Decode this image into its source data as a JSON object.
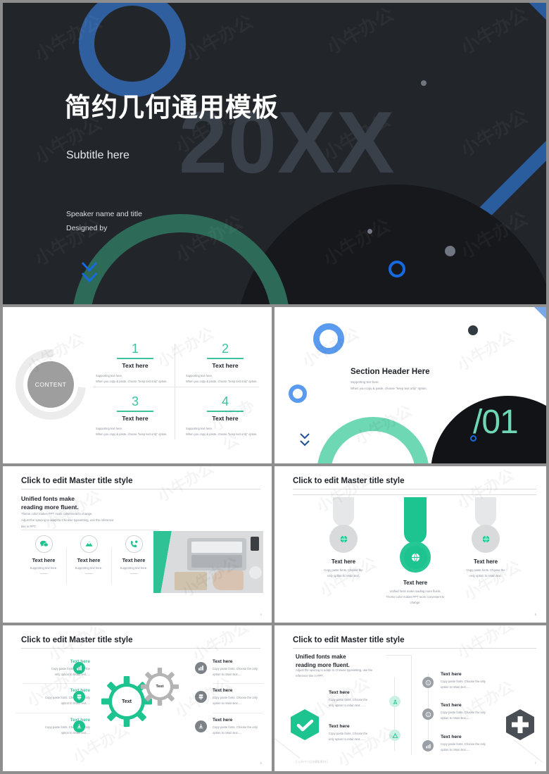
{
  "deck": {
    "accent_teal": "#3ec3a0",
    "accent_green": "#1ec48f",
    "accent_blue": "#2a5d9e",
    "accent_light_blue": "#5b9bef",
    "cover_bg": "#22252a",
    "watermark_text": "小牛办公"
  },
  "slide1": {
    "title": "简约几何通用模板",
    "year": "20XX",
    "subtitle": "Subtitle here",
    "speaker": "Speaker name and title",
    "designer": "Designed by"
  },
  "slide2": {
    "center_label": "CONTENT",
    "items": [
      {
        "num": "1",
        "head": "Text here",
        "sub1": "Supporting text here.",
        "sub2": "When you copy & paste, choose \"keep text only\" option."
      },
      {
        "num": "2",
        "head": "Text here",
        "sub1": "Supporting text here.",
        "sub2": "When you copy & paste, choose \"keep text only\" option."
      },
      {
        "num": "3",
        "head": "Text here",
        "sub1": "Supporting text here.",
        "sub2": "When you copy & paste, choose \"keep text only\" option."
      },
      {
        "num": "4",
        "head": "Text here",
        "sub1": "Supporting text here.",
        "sub2": "When you copy & paste, choose \"keep text only\" option."
      }
    ]
  },
  "slide3": {
    "title": "Section Header Here",
    "sub1": "Supporting text here.",
    "sub2": "When you copy & paste, choose \"keep text only\" option.",
    "number": "/01"
  },
  "slide4": {
    "title": "Click to edit Master title style",
    "heading_l1": "Unified fonts make",
    "heading_l2": "reading more fluent.",
    "body_l1": "Theme color makes PPT more convenient to change.",
    "body_l2": "Adjust the spacing to adapt to Chinese typesetting, use the reference",
    "body_l3": "line in PPT.",
    "items": [
      {
        "icon": "chat-icon",
        "title": "Text here",
        "sub": "Supporting text here."
      },
      {
        "icon": "map-pin-icon",
        "title": "Text here",
        "sub": "Supporting text here."
      },
      {
        "icon": "phone-icon",
        "title": "Text here",
        "sub": "Supporting text here."
      }
    ],
    "page": "4"
  },
  "slide5": {
    "title": "Click to edit Master title style",
    "left": {
      "icon": "globe-icon",
      "title": "Text here",
      "sub1": "Copy paste fonts. Choose the",
      "sub2": "only option to retain text."
    },
    "center": {
      "icon": "globe-icon",
      "title": "Text here",
      "sub1": "Unified fonts make reading more fluent.",
      "sub2": "Theme color makes PPT more convenient to change."
    },
    "right": {
      "icon": "globe-icon",
      "title": "Text here",
      "sub1": "Copy paste fonts. Choose the",
      "sub2": "only option to retain text."
    },
    "page": "5"
  },
  "slide6": {
    "title": "Click to edit Master title style",
    "gear_green_label": "Text",
    "gear_gray_label": "Text",
    "left_items": [
      {
        "icon": "chart-icon",
        "title": "Text here",
        "p1": "Copy paste fonts. Choose the",
        "p2": "only option to retain text....."
      },
      {
        "icon": "server-icon",
        "title": "Text here",
        "p1": "Copy paste fonts. Choose the only",
        "p2": "option to retain text....."
      },
      {
        "icon": "download-icon",
        "title": "Text here",
        "p1": "Copy paste fonts. Choose the only",
        "p2": "option to retain text....."
      }
    ],
    "right_items": [
      {
        "icon": "chart-icon",
        "title": "Text here",
        "p1": "Copy paste fonts. Choose the only",
        "p2": "option to retain text....."
      },
      {
        "icon": "server-icon",
        "title": "Text here",
        "p1": "Copy paste fonts. Choose the only",
        "p2": "option to retain text....."
      },
      {
        "icon": "download-icon",
        "title": "Text here",
        "p1": "Copy paste fonts. Choose the only",
        "p2": "option to retain text....."
      }
    ],
    "page": "6"
  },
  "slide7": {
    "title": "Click to edit Master title style",
    "heading_l1": "Unified fonts make",
    "heading_l2": "reading more fluent.",
    "body_l1": "Adjust the spacing to adapt to Chinese typesetting, use the",
    "body_l2": "reference line in PPT.",
    "left_blocks": [
      {
        "title": "Text here",
        "p1": "Copy paste fonts. Choose the",
        "p2": "only option to retain text.. ...."
      },
      {
        "title": "Text here",
        "p1": "Copy paste fonts. Choose the",
        "p2": "only option to retain text......"
      }
    ],
    "right_blocks": [
      {
        "title": "Text here",
        "p1": "Copy paste fonts. Choose the only",
        "p2": "option to retain text......"
      },
      {
        "title": "Text here",
        "p1": "Copy paste fonts. Choose the only",
        "p2": "option to retain text......"
      },
      {
        "title": "Text here",
        "p1": "Copy paste fonts. Choose the only",
        "p2": "option to retain text......"
      }
    ],
    "footer": "【 公开PPT设计模板素材 】",
    "page": "7"
  }
}
